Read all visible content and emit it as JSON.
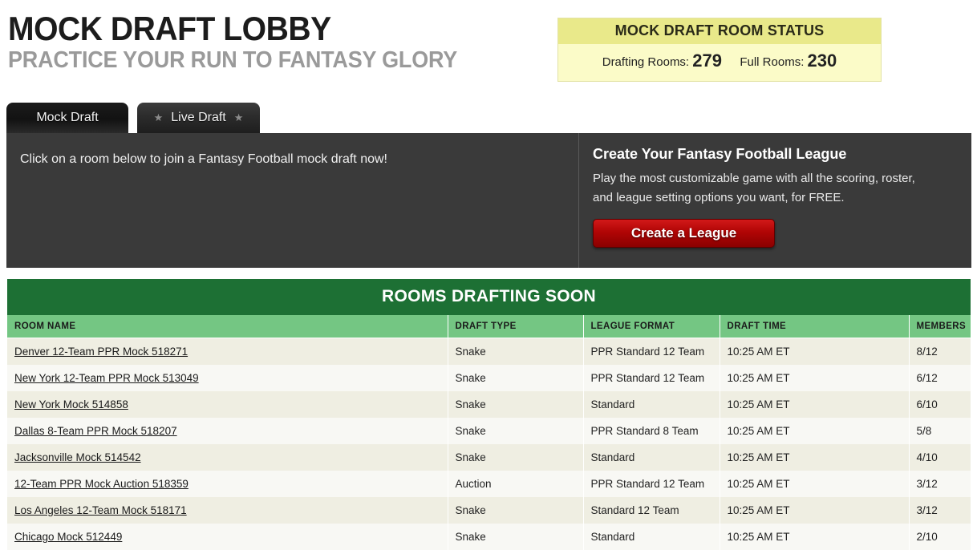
{
  "brand": {
    "title": "MOCK DRAFT LOBBY",
    "subtitle": "PRACTICE YOUR RUN TO FANTASY GLORY"
  },
  "status": {
    "title": "MOCK DRAFT ROOM STATUS",
    "drafting_label": "Drafting Rooms:",
    "drafting_count": "279",
    "full_label": "Full Rooms:",
    "full_count": "230",
    "header_bg": "#e9e98a",
    "body_bg": "#fbfbc8"
  },
  "tabs": [
    {
      "label": "Mock Draft",
      "active": true,
      "star": ""
    },
    {
      "label": "Live Draft",
      "active": false,
      "star": "★"
    }
  ],
  "panel": {
    "left_text": "Click on a room below to join a Fantasy Football mock draft now!",
    "right_title": "Create Your Fantasy Football League",
    "right_body": "Play the most customizable game with all the scoring, roster, and league setting options you want, for FREE.",
    "cta_label": "Create a League",
    "cta_color": "#b00505",
    "bg_color": "#3a3a3a"
  },
  "table": {
    "title": "ROOMS DRAFTING SOON",
    "title_bg": "#1d7034",
    "header_bg": "#74c683",
    "headers": [
      "ROOM NAME",
      "DRAFT TYPE",
      "LEAGUE FORMAT",
      "DRAFT TIME",
      "MEMBERS"
    ],
    "rows": [
      {
        "name": "Denver 12-Team PPR Mock 518271",
        "type": "Snake",
        "format": "PPR Standard 12 Team",
        "time": "10:25 AM ET",
        "members": "8/12"
      },
      {
        "name": "New York 12-Team PPR Mock 513049",
        "type": "Snake",
        "format": "PPR Standard 12 Team",
        "time": "10:25 AM ET",
        "members": "6/12"
      },
      {
        "name": "New York Mock 514858",
        "type": "Snake",
        "format": "Standard",
        "time": "10:25 AM ET",
        "members": "6/10"
      },
      {
        "name": "Dallas 8-Team PPR Mock 518207",
        "type": "Snake",
        "format": "PPR Standard 8 Team",
        "time": "10:25 AM ET",
        "members": "5/8"
      },
      {
        "name": "Jacksonville Mock 514542",
        "type": "Snake",
        "format": "Standard",
        "time": "10:25 AM ET",
        "members": "4/10"
      },
      {
        "name": "12-Team PPR Mock Auction 518359",
        "type": "Auction",
        "format": "PPR Standard 12 Team",
        "time": "10:25 AM ET",
        "members": "3/12"
      },
      {
        "name": "Los Angeles 12-Team Mock 518171",
        "type": "Snake",
        "format": "Standard 12 Team",
        "time": "10:25 AM ET",
        "members": "3/12"
      },
      {
        "name": "Chicago Mock 512449",
        "type": "Snake",
        "format": "Standard",
        "time": "10:25 AM ET",
        "members": "2/10"
      }
    ]
  }
}
